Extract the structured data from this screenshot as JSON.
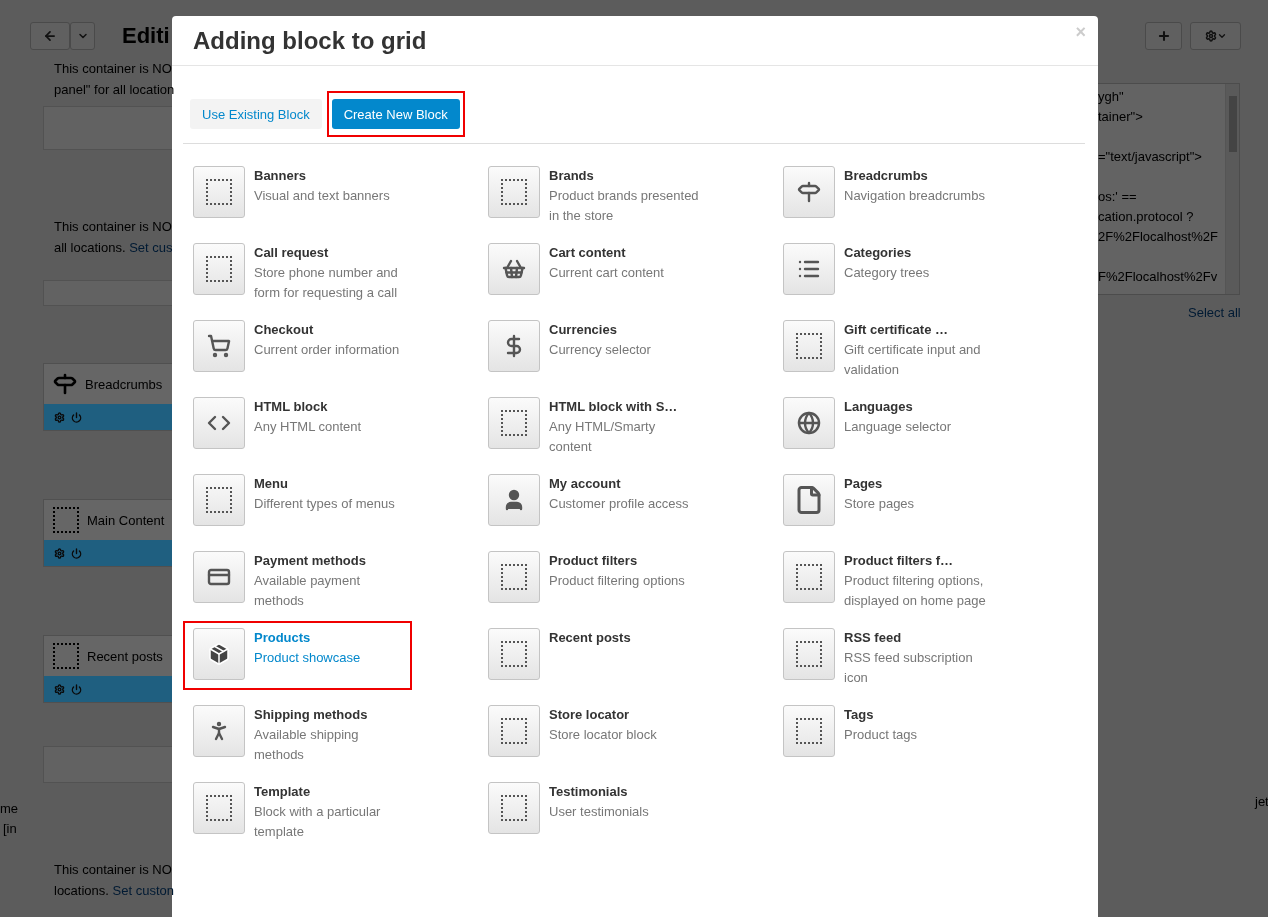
{
  "background": {
    "title": "Editi",
    "notes_top": [
      {
        "lines": [
          "This container is NO",
          "panel\" for all location"
        ]
      },
      {
        "lines": [
          "This container is NO",
          "all locations."
        ],
        "link": "Set cus"
      }
    ],
    "blocks": [
      {
        "kind": "signpost",
        "name": "Breadcrumbs"
      },
      {
        "kind": "placeholder",
        "name": "Main Content"
      },
      {
        "kind": "placeholder",
        "name": "Recent posts"
      }
    ],
    "side_fragments": [
      "me",
      "[in"
    ],
    "notes_bottom": [
      {
        "lines": [
          "This container is NO",
          "locations."
        ],
        "link": "Set custon"
      }
    ],
    "code_blocks": [
      {
        "lines": [
          "ygh\"",
          "tainer\">"
        ]
      },
      {
        "lines": [
          "=\"text/javascript\">"
        ]
      },
      {
        "lines": [
          "os:' ==",
          "cation.protocol ?",
          "2F%2Flocalhost%2F"
        ]
      },
      {
        "lines": [
          "F%2Flocalhost%2Fv"
        ]
      }
    ],
    "select_all": "Select all",
    "right_fragment": "jet"
  },
  "dialog": {
    "title": "Adding block to grid",
    "close": "×",
    "tabs": [
      {
        "label": "Use Existing Block",
        "selected": false,
        "highlighted": false
      },
      {
        "label": "Create New Block",
        "selected": true,
        "highlighted": true
      }
    ],
    "blocks": [
      {
        "kind": "placeholder",
        "title": "Banners",
        "description": "Visual and text banners",
        "selected": false,
        "highlighted": false
      },
      {
        "kind": "placeholder",
        "title": "Brands",
        "description": "Product brands presented in the store",
        "selected": false,
        "highlighted": false
      },
      {
        "kind": "signpost",
        "title": "Breadcrumbs",
        "description": "Navigation breadcrumbs",
        "selected": false,
        "highlighted": false
      },
      {
        "kind": "placeholder",
        "title": "Call request",
        "description": "Store phone number and form for requesting a call",
        "selected": false,
        "highlighted": false
      },
      {
        "kind": "basket",
        "title": "Cart content",
        "description": "Current cart content",
        "selected": false,
        "highlighted": false
      },
      {
        "kind": "list",
        "title": "Categories",
        "description": "Category trees",
        "selected": false,
        "highlighted": false
      },
      {
        "kind": "cart",
        "title": "Checkout",
        "description": "Current order information",
        "selected": false,
        "highlighted": false
      },
      {
        "kind": "dollar",
        "title": "Currencies",
        "description": "Currency selector",
        "selected": false,
        "highlighted": false
      },
      {
        "kind": "placeholder",
        "title": "Gift certificate …",
        "description": "Gift certificate input and validation",
        "selected": false,
        "highlighted": false
      },
      {
        "kind": "code",
        "title": "HTML block",
        "description": "Any HTML content",
        "selected": false,
        "highlighted": false
      },
      {
        "kind": "placeholder",
        "title": "HTML block with S…",
        "description": "Any HTML/Smarty content",
        "selected": false,
        "highlighted": false
      },
      {
        "kind": "globe",
        "title": "Languages",
        "description": "Language selector",
        "selected": false,
        "highlighted": false
      },
      {
        "kind": "placeholder",
        "title": "Menu",
        "description": "Different types of menus",
        "selected": false,
        "highlighted": false
      },
      {
        "kind": "user",
        "title": "My account",
        "description": "Customer profile access",
        "selected": false,
        "highlighted": false
      },
      {
        "kind": "page",
        "title": "Pages",
        "description": "Store pages",
        "selected": false,
        "highlighted": false
      },
      {
        "kind": "card",
        "title": "Payment methods",
        "description": "Available payment methods",
        "selected": false,
        "highlighted": false
      },
      {
        "kind": "placeholder",
        "title": "Product filters",
        "description": "Product filtering options",
        "selected": false,
        "highlighted": false
      },
      {
        "kind": "placeholder",
        "title": "Product filters f…",
        "description": "Product filtering options, displayed on home page",
        "selected": false,
        "highlighted": false
      },
      {
        "kind": "box",
        "title": "Products",
        "description": "Product showcase",
        "selected": true,
        "highlighted": true
      },
      {
        "kind": "placeholder",
        "title": "Recent posts",
        "selected": false,
        "highlighted": false
      },
      {
        "kind": "placeholder",
        "title": "RSS feed",
        "description": "RSS feed subscription icon",
        "selected": false,
        "highlighted": false
      },
      {
        "kind": "runner",
        "title": "Shipping methods",
        "description": "Available shipping methods",
        "selected": false,
        "highlighted": false
      },
      {
        "kind": "placeholder",
        "title": "Store locator",
        "description": "Store locator block",
        "selected": false,
        "highlighted": false
      },
      {
        "kind": "placeholder",
        "title": "Tags",
        "description": "Product tags",
        "selected": false,
        "highlighted": false
      },
      {
        "kind": "placeholder",
        "title": "Template",
        "description": "Block with a particular template",
        "selected": false,
        "highlighted": false
      },
      {
        "kind": "placeholder",
        "title": "Testimonials",
        "description": "User testimonials",
        "selected": false,
        "highlighted": false
      }
    ]
  }
}
